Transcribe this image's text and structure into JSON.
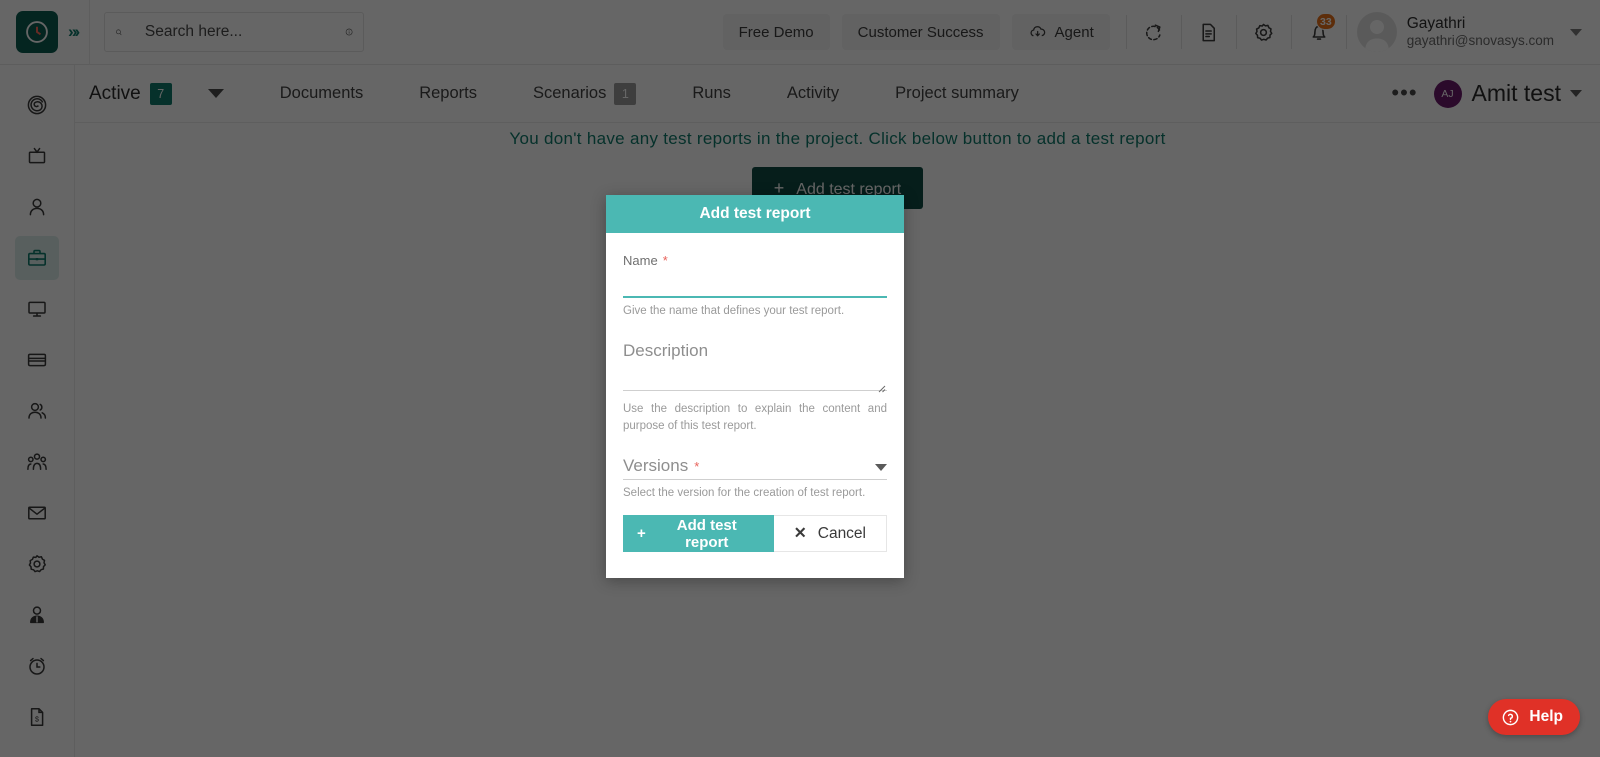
{
  "header": {
    "logo_icon": "clock-logo-icon",
    "expand_icon": "chevrons-right-icon",
    "search": {
      "placeholder": "Search here...",
      "value": "",
      "search_icon": "search-icon",
      "info_icon": "info-circle-icon"
    },
    "buttons": [
      {
        "label": "Free Demo",
        "name": "free-demo-button",
        "icon": null
      },
      {
        "label": "Customer Success",
        "name": "customer-success-button",
        "icon": null
      },
      {
        "label": "Agent",
        "name": "agent-button",
        "icon": "cloud-download-icon"
      }
    ],
    "icons": [
      {
        "name": "refresh-icon",
        "glyph": "refresh"
      },
      {
        "name": "document-icon",
        "glyph": "document"
      },
      {
        "name": "settings-gear-icon",
        "glyph": "gear"
      },
      {
        "name": "notifications-bell-icon",
        "glyph": "bell",
        "badge": "33"
      }
    ],
    "user": {
      "name": "Gayathri",
      "email": "gayathri@snovasys.com",
      "avatar_icon": "user-avatar-icon",
      "caret_icon": "chevron-down-icon"
    }
  },
  "sidebar": {
    "items": [
      {
        "name": "sidebar-item-target",
        "icon": "target-spiral-icon",
        "active": false
      },
      {
        "name": "sidebar-item-tv",
        "icon": "tv-icon",
        "active": false
      },
      {
        "name": "sidebar-item-profile",
        "icon": "person-icon",
        "active": false
      },
      {
        "name": "sidebar-item-projects",
        "icon": "briefcase-icon",
        "active": true
      },
      {
        "name": "sidebar-item-desktop",
        "icon": "monitor-icon",
        "active": false
      },
      {
        "name": "sidebar-item-billing",
        "icon": "credit-card-icon",
        "active": false
      },
      {
        "name": "sidebar-item-users",
        "icon": "users-icon",
        "active": false
      },
      {
        "name": "sidebar-item-teams",
        "icon": "group-icon",
        "active": false
      },
      {
        "name": "sidebar-item-mail",
        "icon": "envelope-icon",
        "active": false
      },
      {
        "name": "sidebar-item-settings",
        "icon": "gear-icon",
        "active": false
      },
      {
        "name": "sidebar-item-employee",
        "icon": "person-badge-icon",
        "active": false
      },
      {
        "name": "sidebar-item-timesheet",
        "icon": "alarm-clock-icon",
        "active": false
      },
      {
        "name": "sidebar-item-invoices",
        "icon": "invoice-document-icon",
        "active": false
      }
    ]
  },
  "subnav": {
    "status_label": "Active",
    "status_count": "7",
    "filter_icon": "triangle-down-icon",
    "tabs": [
      {
        "label": "Documents",
        "count": null
      },
      {
        "label": "Reports",
        "count": null
      },
      {
        "label": "Scenarios",
        "count": "1"
      },
      {
        "label": "Runs",
        "count": null
      },
      {
        "label": "Activity",
        "count": null
      },
      {
        "label": "Project summary",
        "count": null
      }
    ],
    "more_icon": "ellipsis-icon",
    "project": {
      "initials": "AJ",
      "name": "Amit test",
      "caret_icon": "chevron-down-icon"
    }
  },
  "content": {
    "empty_message": "You don't have any test reports in the project. Click below button to add a test report",
    "add_button_label": "Add test report",
    "add_button_icon": "plus-icon"
  },
  "modal": {
    "title": "Add test report",
    "name_field": {
      "label": "Name",
      "required_mark": "*",
      "value": "",
      "placeholder": "",
      "helper": "Give the name that defines your test report."
    },
    "description_field": {
      "label": "Description",
      "value": "",
      "placeholder": "",
      "helper": "Use the description to explain the content and purpose of this test report.",
      "resize_icon": "resize-grip-icon"
    },
    "versions_field": {
      "label": "Versions",
      "required_mark": "*",
      "value": "",
      "helper": "Select the version for the creation of test report.",
      "caret_icon": "chevron-down-icon"
    },
    "submit_label": "Add test report",
    "submit_icon": "plus-icon",
    "cancel_label": "Cancel",
    "cancel_icon": "close-x-icon"
  },
  "help": {
    "label": "Help",
    "icon": "question-circle-icon"
  },
  "colors": {
    "teal": "#4bb8b3",
    "dark_teal": "#0f7b6c",
    "deep_teal": "#0f4d44",
    "badge_orange": "#e8711a",
    "help_red": "#e03127",
    "project_purple": "#6d1b6d",
    "required_red": "#e8625a"
  }
}
